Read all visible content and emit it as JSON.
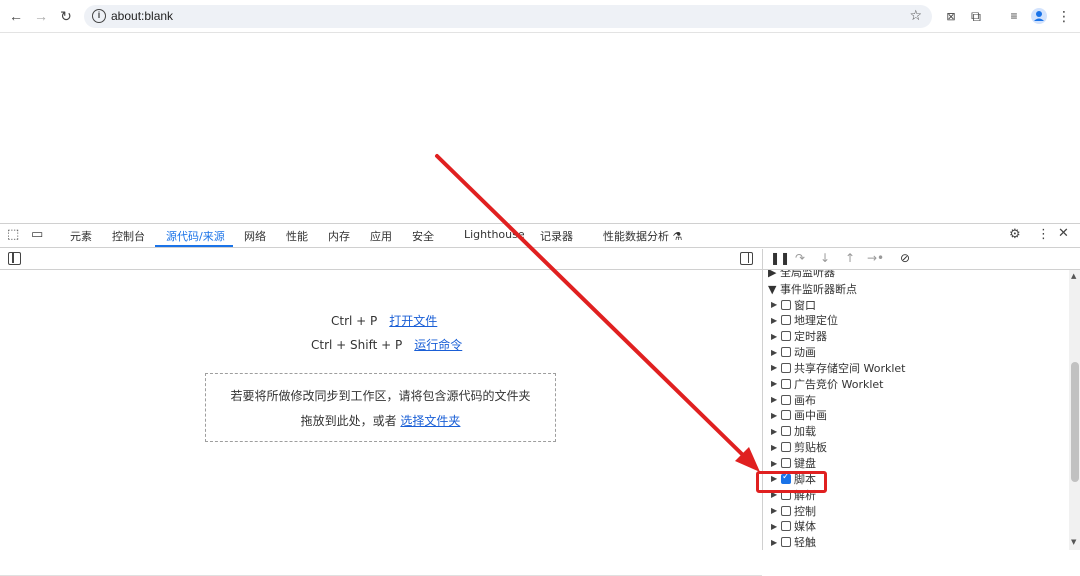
{
  "browser": {
    "url": "about:blank"
  },
  "devtools": {
    "tabs": [
      "元素",
      "控制台",
      "源代码/来源",
      "网络",
      "性能",
      "内存",
      "应用",
      "安全",
      "Lighthouse",
      "记录器",
      "性能数据分析 ⚗"
    ],
    "active_tab": "源代码/来源",
    "editor": {
      "shortcut1_keys": "Ctrl + P",
      "shortcut1_action": "打开文件",
      "shortcut2_keys": "Ctrl + Shift + P",
      "shortcut2_action": "运行命令",
      "dropzone_line1": "若要将所做修改同步到工作区，请将包含源代码的文件夹",
      "dropzone_line2_prefix": "拖放到此处，或者",
      "dropzone_link": "选择文件夹"
    },
    "breakpoints": {
      "partial_section": "全局监听器",
      "section_title": "事件监听器断点",
      "items": [
        {
          "label": "窗口",
          "checked": false
        },
        {
          "label": "地理定位",
          "checked": false
        },
        {
          "label": "定时器",
          "checked": false
        },
        {
          "label": "动画",
          "checked": false
        },
        {
          "label": "共享存储空间 Worklet",
          "checked": false
        },
        {
          "label": "广告竞价 Worklet",
          "checked": false
        },
        {
          "label": "画布",
          "checked": false
        },
        {
          "label": "画中画",
          "checked": false
        },
        {
          "label": "加载",
          "checked": false
        },
        {
          "label": "剪贴板",
          "checked": false
        },
        {
          "label": "键盘",
          "checked": false
        },
        {
          "label": "脚本",
          "checked": true
        },
        {
          "label": "解析",
          "checked": false
        },
        {
          "label": "控制",
          "checked": false
        },
        {
          "label": "媒体",
          "checked": false
        },
        {
          "label": "轻触",
          "checked": false
        }
      ]
    }
  },
  "colors": {
    "accent": "#1a73e8",
    "annotation": "#e02020"
  }
}
